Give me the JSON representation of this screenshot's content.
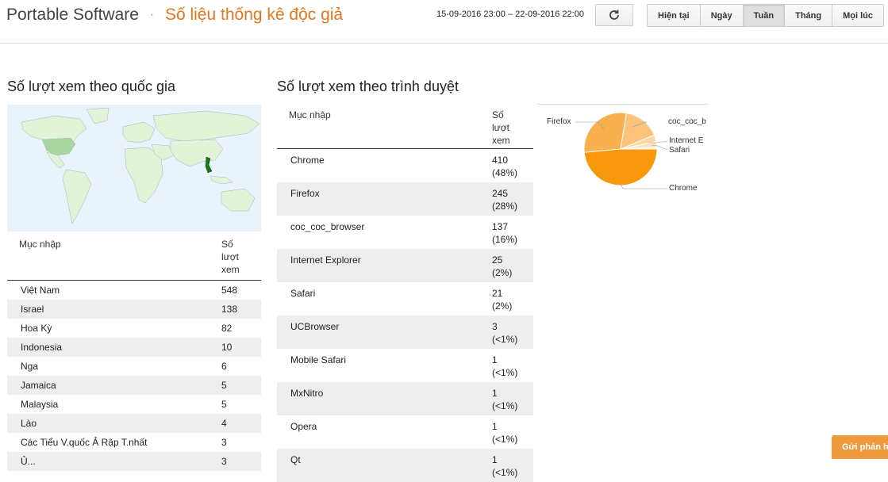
{
  "header": {
    "blog_name": "Portable Software",
    "separator": "·",
    "page_title": "Số liệu thống kê độc giả",
    "date_range": "15-09-2016 23:00 – 22-09-2016 22:00",
    "range_buttons": [
      "Hiện tại",
      "Ngày",
      "Tuần",
      "Tháng",
      "Mọi lúc"
    ],
    "active_range": "Tuần"
  },
  "country_section": {
    "heading": "Số lượt xem theo quốc gia",
    "col_entry": "Mục nhập",
    "col_views_lines": [
      "Số",
      "lượt",
      "xem"
    ],
    "rows": [
      {
        "name": "Việt Nam",
        "views": "548"
      },
      {
        "name": "Israel",
        "views": "138"
      },
      {
        "name": "Hoa Kỳ",
        "views": "82"
      },
      {
        "name": "Indonesia",
        "views": "10"
      },
      {
        "name": "Nga",
        "views": "6"
      },
      {
        "name": "Jamaica",
        "views": "5"
      },
      {
        "name": "Malaysia",
        "views": "5"
      },
      {
        "name": "Lào",
        "views": "4"
      },
      {
        "name": "Các Tiểu V.quốc Ả Rập T.nhất",
        "views": "3"
      },
      {
        "name": "Ủ...",
        "views": "3"
      }
    ]
  },
  "browser_section": {
    "heading": "Số lượt xem theo trình duyệt",
    "col_entry": "Mục nhập",
    "col_views_lines": [
      "Số",
      "lượt",
      "xem"
    ],
    "rows": [
      {
        "name": "Chrome",
        "views": "410",
        "pct": "(48%)"
      },
      {
        "name": "Firefox",
        "views": "245",
        "pct": "(28%)"
      },
      {
        "name": "coc_coc_browser",
        "views": "137",
        "pct": "(16%)"
      },
      {
        "name": "Internet Explorer",
        "views": "25",
        "pct": "(2%)"
      },
      {
        "name": "Safari",
        "views": "21",
        "pct": "(2%)"
      },
      {
        "name": "UCBrowser",
        "views": "3",
        "pct": "(<1%)"
      },
      {
        "name": "Mobile Safari",
        "views": "1",
        "pct": "(<1%)"
      },
      {
        "name": "MxNitro",
        "views": "1",
        "pct": "(<1%)"
      },
      {
        "name": "Opera",
        "views": "1",
        "pct": "(<1%)"
      },
      {
        "name": "Qt",
        "views": "1",
        "pct": "(<1%)"
      }
    ]
  },
  "pie_labels": {
    "firefox": "Firefox",
    "coccoc": "coc_coc_b",
    "ie": "Internet E",
    "safari": "Safari",
    "chrome": "Chrome"
  },
  "colors": {
    "accent": "#e8761d",
    "pie_chrome": "#f7980e",
    "pie_firefox": "#f9b04e",
    "pie_coccoc": "#fbc47c",
    "pie_ie": "#fcd7a4",
    "pie_safari": "#fde2bc",
    "map_highlight": "#1a7a1a",
    "map_mid": "#a9d6a0",
    "map_light": "#e2f3d8"
  },
  "feedback_button": "Gửi phản hồi"
}
